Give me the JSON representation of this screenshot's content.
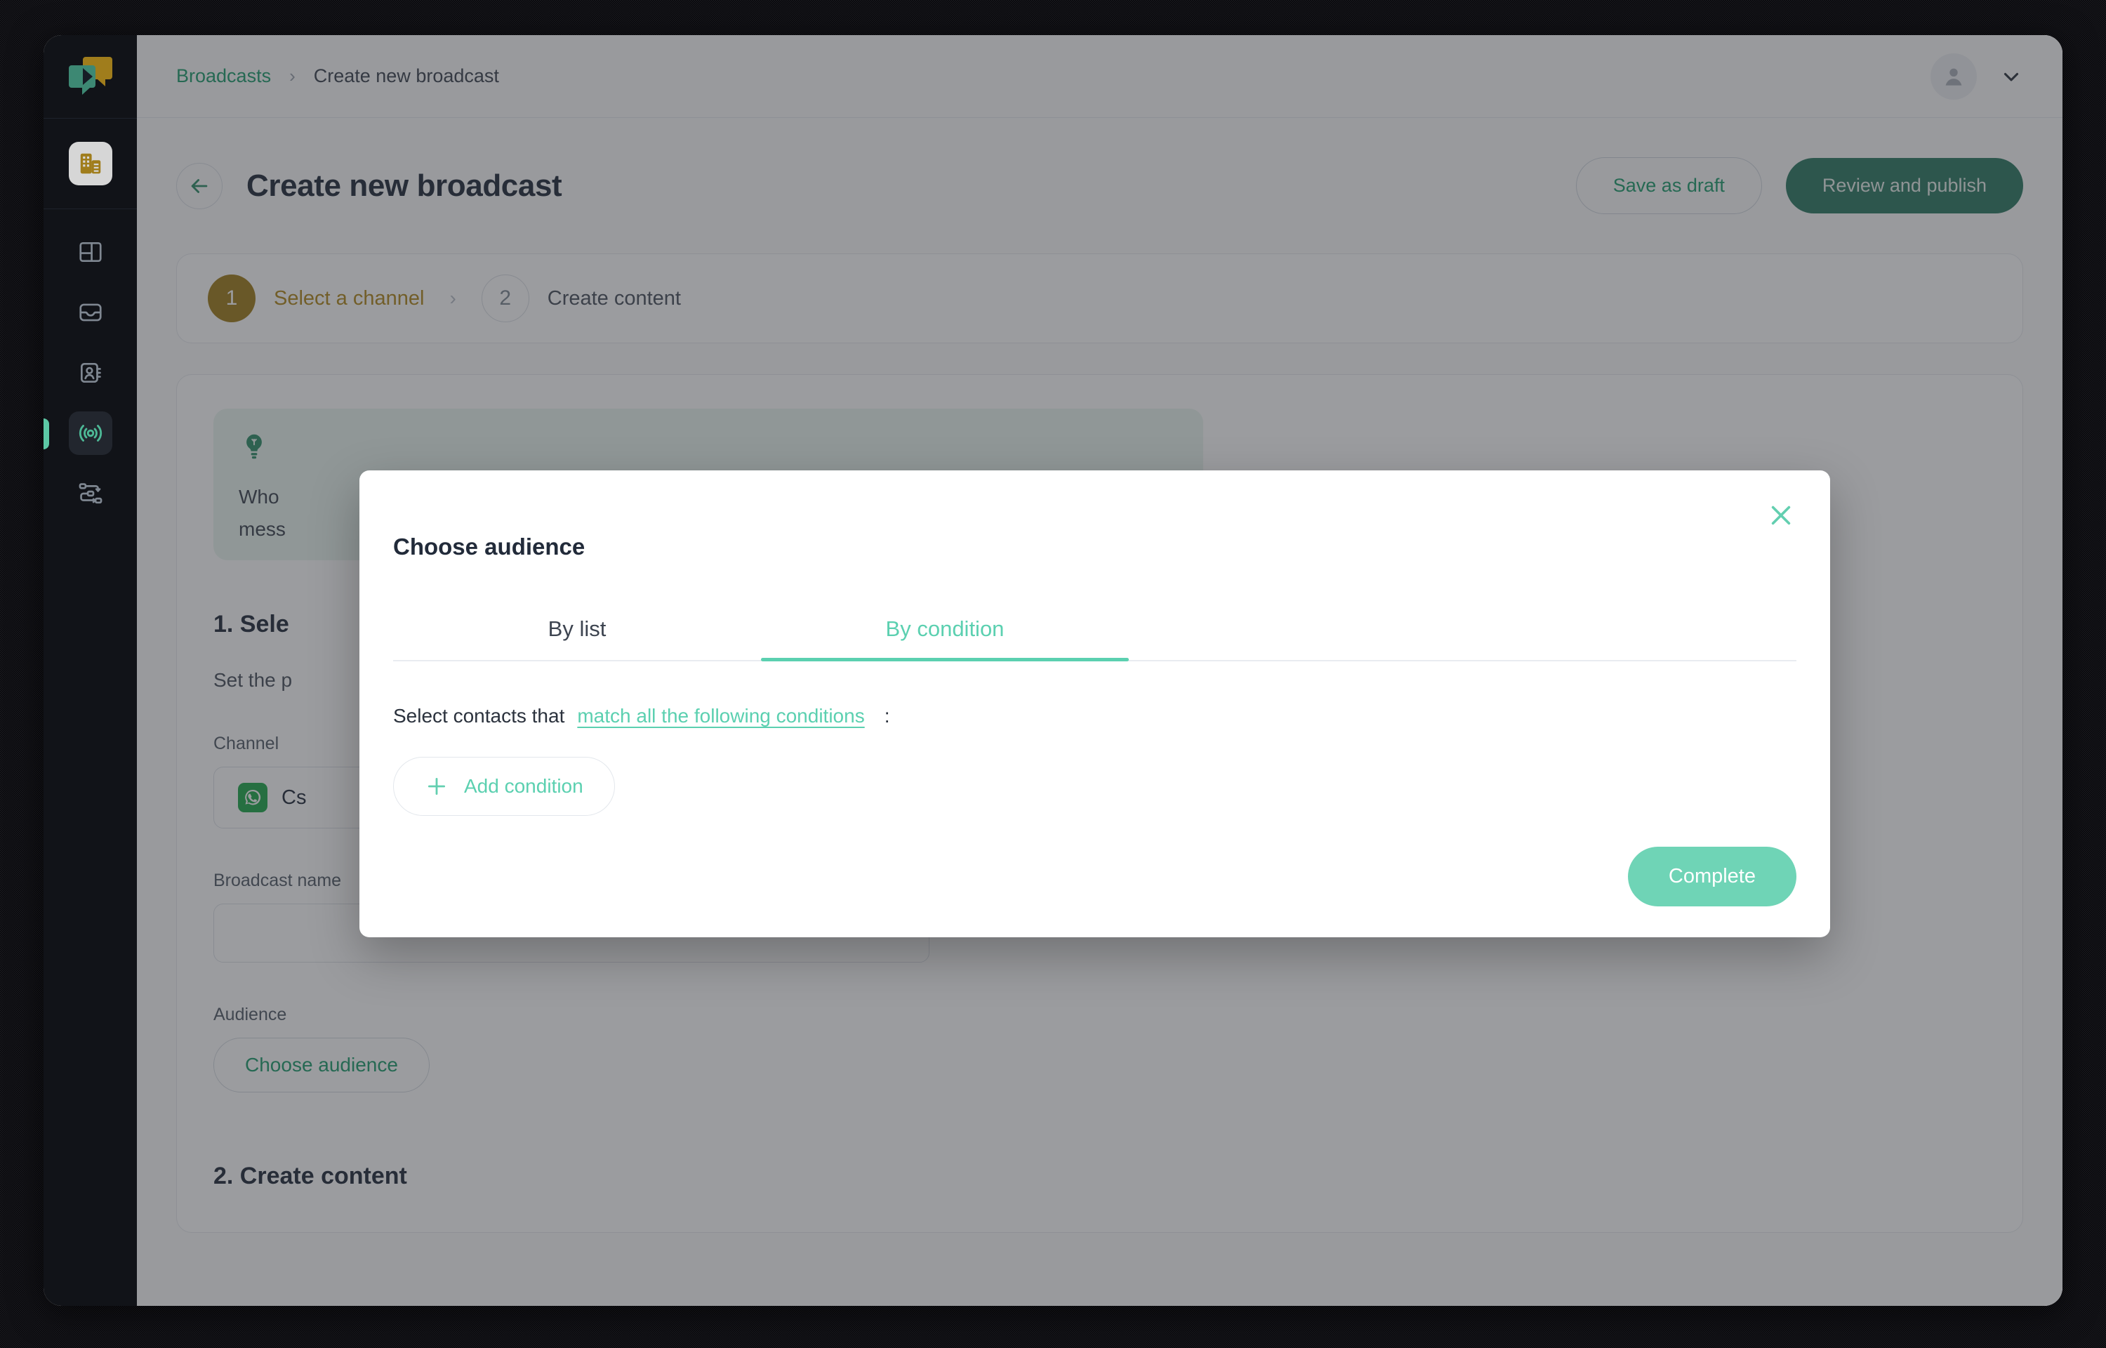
{
  "sidebar": {
    "logo_icon": "chat-bubbles-logo",
    "workspace_icon": "workspace-building-icon",
    "items": [
      {
        "icon": "dashboard-grid-icon",
        "name": "dashboard",
        "active": false
      },
      {
        "icon": "inbox-icon",
        "name": "inbox",
        "active": false
      },
      {
        "icon": "contacts-icon",
        "name": "contacts",
        "active": false
      },
      {
        "icon": "broadcast-icon",
        "name": "broadcasts",
        "active": true
      },
      {
        "icon": "workflow-icon",
        "name": "workflows",
        "active": false
      }
    ]
  },
  "topbar": {
    "breadcrumb_root": "Broadcasts",
    "breadcrumb_sep": "›",
    "breadcrumb_current": "Create new broadcast",
    "avatar_icon": "user-avatar-icon",
    "chevron_icon": "chevron-down-icon"
  },
  "page": {
    "back_icon": "arrow-left-icon",
    "title": "Create new broadcast",
    "save_draft_label": "Save as draft",
    "review_publish_label": "Review and publish"
  },
  "stepper": {
    "steps": [
      {
        "number": "1",
        "label": "Select a channel",
        "state": "done"
      },
      {
        "number": "2",
        "label": "Create content",
        "state": "todo"
      }
    ],
    "arrow": "›"
  },
  "main": {
    "tip_icon": "lightbulb-icon",
    "tip_line1": "Who",
    "tip_line2": "mess",
    "section1_title": "1. Sele",
    "section1_sub": "Set the p",
    "channel_label": "Channel",
    "channel_value": "Cs",
    "channel_icon": "whatsapp-icon",
    "broadcast_name_label": "Broadcast name",
    "broadcast_name_value": "",
    "broadcast_name_placeholder": "",
    "audience_label": "Audience",
    "choose_audience_label": "Choose audience",
    "section2_title": "2. Create content"
  },
  "modal": {
    "title": "Choose audience",
    "close_icon": "close-icon",
    "tabs": [
      {
        "label": "By list",
        "active": false
      },
      {
        "label": "By condition",
        "active": true
      }
    ],
    "condition_prefix": "Select contacts that",
    "condition_link": "match all the following conditions",
    "condition_colon": ":",
    "add_condition_label": "Add condition",
    "add_condition_icon": "plus-icon",
    "complete_label": "Complete"
  },
  "colors": {
    "accent_mint": "#5bd0b0",
    "accent_green": "#1f9d6d",
    "primary_dark_green": "#2c7a62",
    "step_gold": "#a07d1c",
    "sidebar_bg": "#111318"
  }
}
